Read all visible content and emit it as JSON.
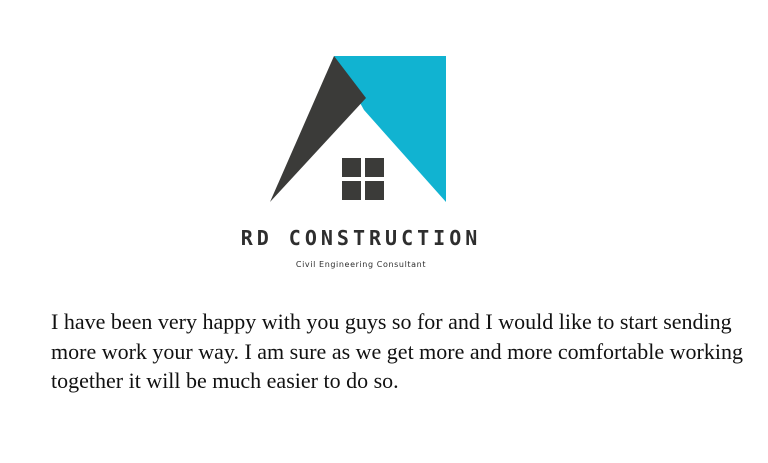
{
  "brand": {
    "name": "RD CONSTRUCTION",
    "tagline": "Civil Engineering Consultant"
  },
  "colors": {
    "roof_dark": "#3b3b39",
    "roof_accent": "#11b3d1",
    "window": "#3b3b39",
    "text": "#111111"
  },
  "icons": {
    "logo": "house-roof-logo-icon"
  },
  "testimonial": {
    "text": "I have been very happy with you guys so for and I would like to start sending more work your way. I am sure as we get more and more comfortable working together it will be much easier to do so."
  }
}
